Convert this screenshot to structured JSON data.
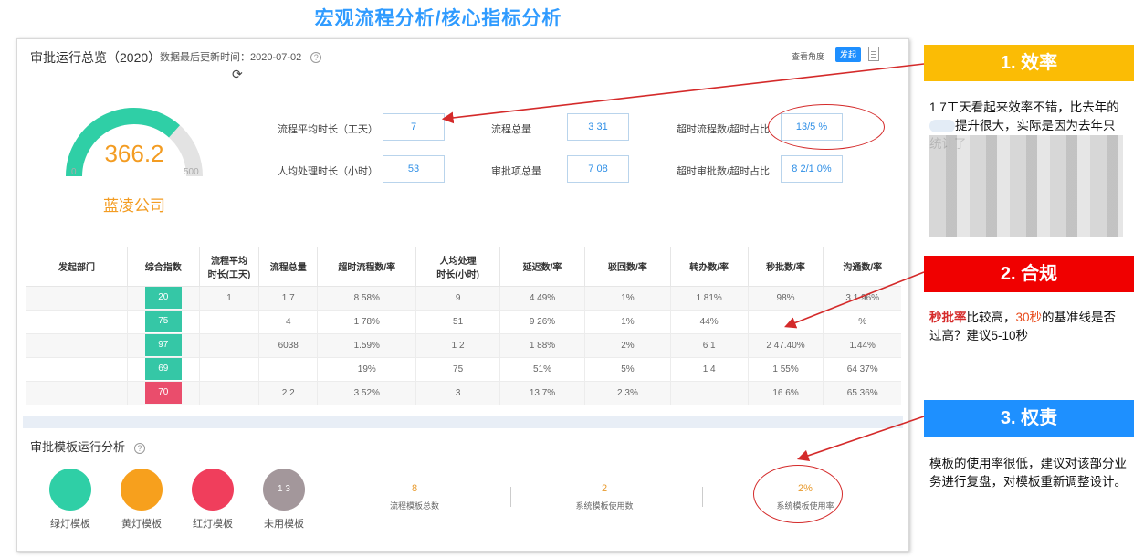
{
  "page_title": "宏观流程分析/核心指标分析",
  "overview": {
    "title": "审批运行总览（2020）",
    "updated_label": "数据最后更新时间：2020-07-02",
    "view_label": "查看角度",
    "view_button": "发起",
    "gauge": {
      "value": "366.2",
      "min": "0",
      "max": "500",
      "fraction": 0.7324,
      "company": "蓝凌公司"
    },
    "metrics": [
      {
        "label": "流程平均时长（工天）",
        "value": "7"
      },
      {
        "label": "流程总量",
        "value": "3  31"
      },
      {
        "label": "超时流程数/超时占比",
        "value": "13/5  %"
      },
      {
        "label": "人均处理时长（小时）",
        "value": "53"
      },
      {
        "label": "审批项总量",
        "value": "7  08"
      },
      {
        "label": "超时审批数/超时占比",
        "value": "8  2/1  0%"
      }
    ]
  },
  "table": {
    "headers": [
      "发起部门",
      "综合指数",
      "流程平均\n时长(工天)",
      "流程总量",
      "超时流程数/率",
      "人均处理\n时长(小时)",
      "延迟数/率",
      "驳回数/率",
      "转办数/率",
      "秒批数/率",
      "沟通数/率"
    ],
    "rows": [
      [
        "",
        "20",
        "1",
        "1  7",
        "8  58%",
        "9",
        "4  49%",
        "1%",
        "1  81%",
        "98%",
        "3  1.96%"
      ],
      [
        "",
        "75",
        "",
        "4",
        "1  78%",
        "51",
        "9  26%",
        "1%",
        "44%",
        "",
        "%"
      ],
      [
        "",
        "97",
        "",
        "6038",
        "1.59%",
        "1  2",
        "1  88%",
        "2%",
        "6  1",
        "2  47.40%",
        "1.44%"
      ],
      [
        "",
        "69",
        "",
        "",
        "19%",
        "75",
        "51%",
        "5%",
        "1  4",
        "1  55%",
        "64  37%"
      ],
      [
        "",
        "70",
        "",
        "2  2",
        "3  52%",
        "3",
        "13  7%",
        "2  3%",
        "",
        "16  6%",
        "65  36%"
      ]
    ],
    "score_colors": [
      "green",
      "green",
      "green",
      "green",
      "red"
    ]
  },
  "templates": {
    "title": "审批模板运行分析",
    "items": [
      {
        "label": "绿灯模板",
        "value": "",
        "color": "#2fcfa6"
      },
      {
        "label": "黄灯模板",
        "value": "",
        "color": "#f7a01d"
      },
      {
        "label": "红灯模板",
        "value": "",
        "color": "#f03e5c"
      },
      {
        "label": "未用模板",
        "value": "1  3",
        "color": "#a3979b"
      }
    ],
    "stats": [
      {
        "value": "8",
        "label": "流程模板总数"
      },
      {
        "value": "2",
        "label": "系统模板使用数"
      },
      {
        "value": "2%",
        "label": "系统模板使用率"
      }
    ]
  },
  "callouts": [
    {
      "title": "1. 效率",
      "color": "#fbbc05",
      "text_a": "1  7工天看起来效率不错，比去年的",
      "text_b": "提升很大，实际是因为去年只统计了",
      "text_c": ""
    },
    {
      "title": "2. 合规",
      "color": "#f00000",
      "highlight": "秒批率",
      "text_a": "比较高，",
      "highlight2": "30秒",
      "text_b": "的基准线是否过高？建议5-10秒"
    },
    {
      "title": "3. 权责",
      "color": "#1e90ff",
      "text_a": "模板的使用率很低，建议对该部分业务进行复盘，对模板重新调整设计。"
    }
  ]
}
